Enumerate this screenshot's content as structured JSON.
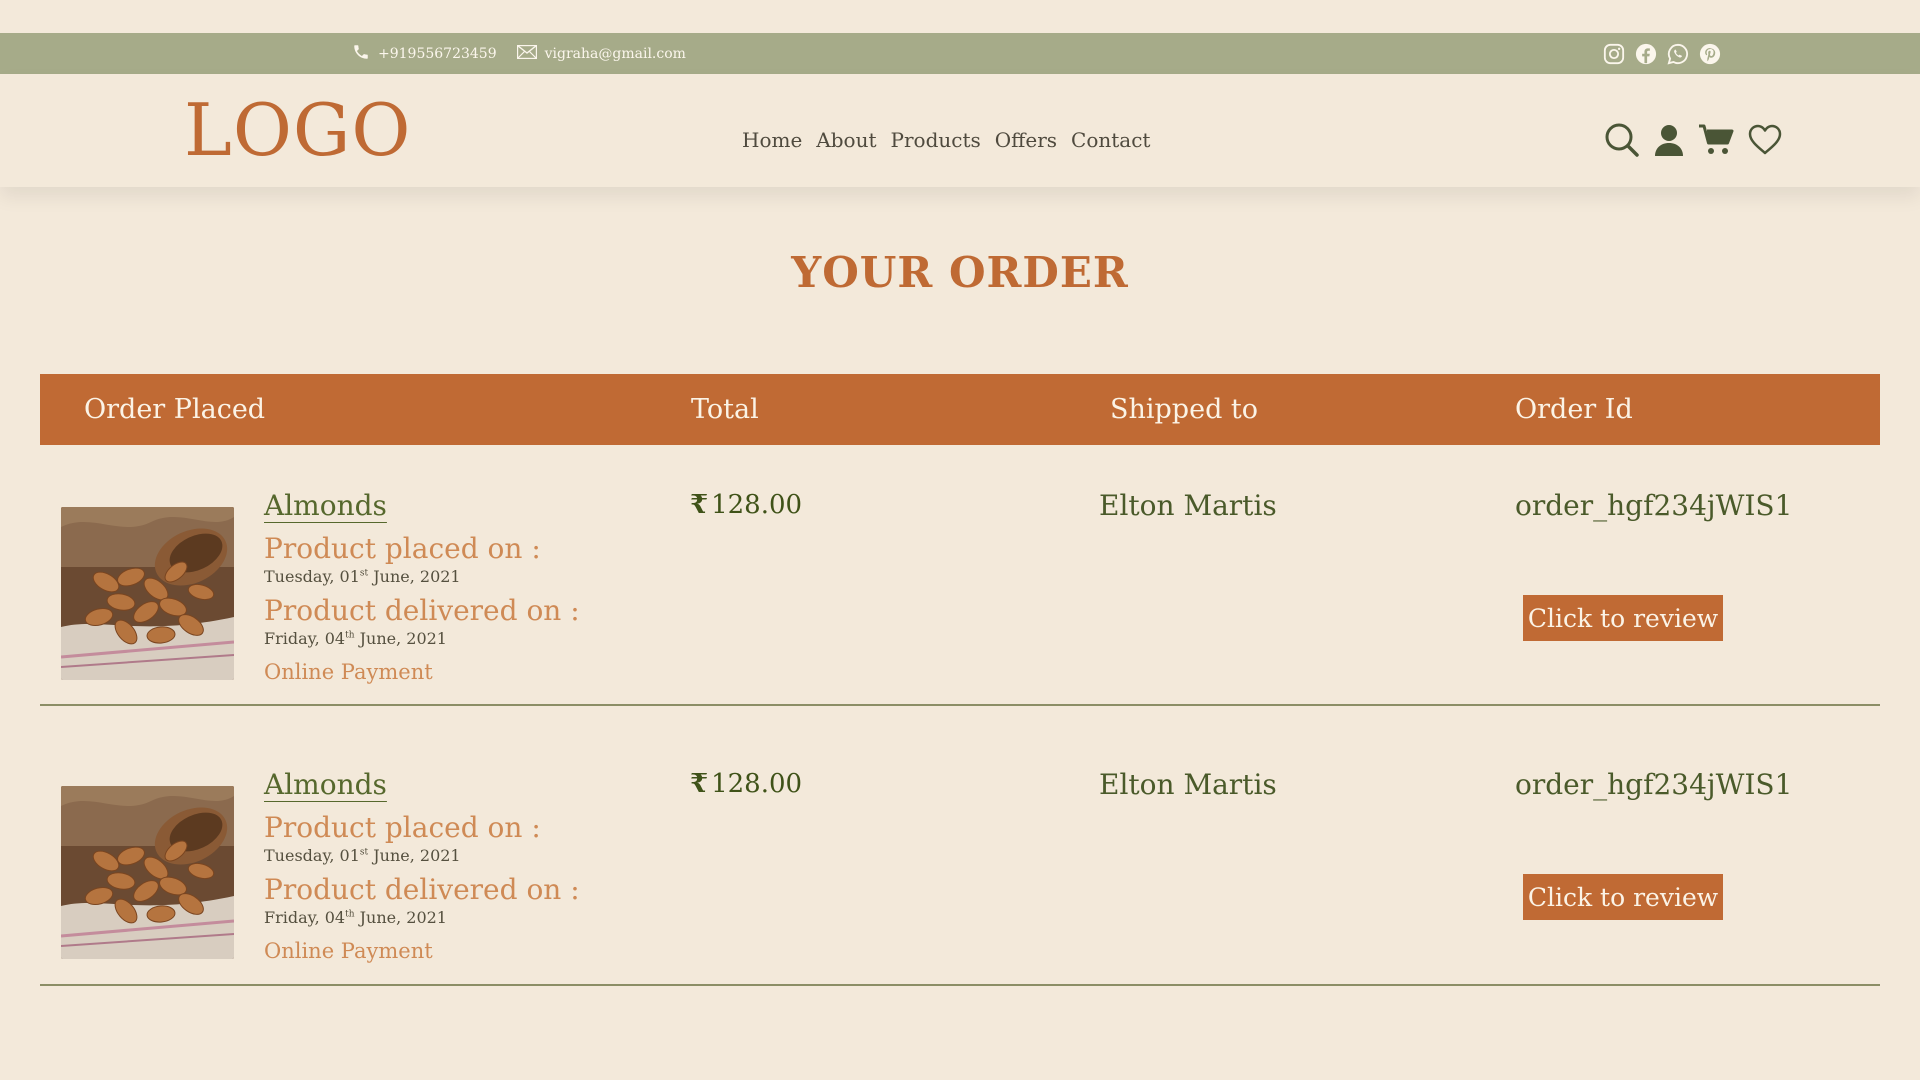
{
  "topbar": {
    "phone": "+919556723459",
    "email": "vigraha@gmail.com",
    "social": [
      "instagram-icon",
      "facebook-icon",
      "whatsapp-icon",
      "pinterest-icon"
    ]
  },
  "header": {
    "logo": "LOGO",
    "nav": [
      "Home",
      "About",
      "Products",
      "Offers",
      "Contact"
    ],
    "icons": [
      "search-icon",
      "user-icon",
      "cart-icon",
      "heart-icon"
    ]
  },
  "page": {
    "title": "YOUR ORDER"
  },
  "table": {
    "columns": [
      "Order Placed",
      "Total",
      "Shipped to",
      "Order Id"
    ]
  },
  "orders": [
    {
      "product": "Almonds",
      "placed_label": "Product placed on :",
      "placed_date": {
        "before": "Tuesday, 01",
        "sup": "st",
        "after": " June, 2021"
      },
      "delivered_label": "Product delivered on :",
      "delivered_date": {
        "before": "Friday, 04",
        "sup": "th",
        "after": " June, 2021"
      },
      "payment": "Online Payment",
      "currency": "₹",
      "total": "128.00",
      "shipped_to": "Elton Martis",
      "order_id": "order_hgf234jWIS1",
      "review_label": "Click to review"
    },
    {
      "product": "Almonds",
      "placed_label": "Product placed on :",
      "placed_date": {
        "before": "Tuesday, 01",
        "sup": "st",
        "after": " June, 2021"
      },
      "delivered_label": "Product delivered on :",
      "delivered_date": {
        "before": "Friday, 04",
        "sup": "th",
        "after": " June, 2021"
      },
      "payment": "Online Payment",
      "currency": "₹",
      "total": "128.00",
      "shipped_to": "Elton Martis",
      "order_id": "order_hgf234jWIS1",
      "review_label": "Click to review"
    }
  ],
  "colors": {
    "accent": "#c06a34",
    "topbar": "#a6ab89",
    "background": "#f3e9da",
    "text_green": "#4a5a2a"
  }
}
